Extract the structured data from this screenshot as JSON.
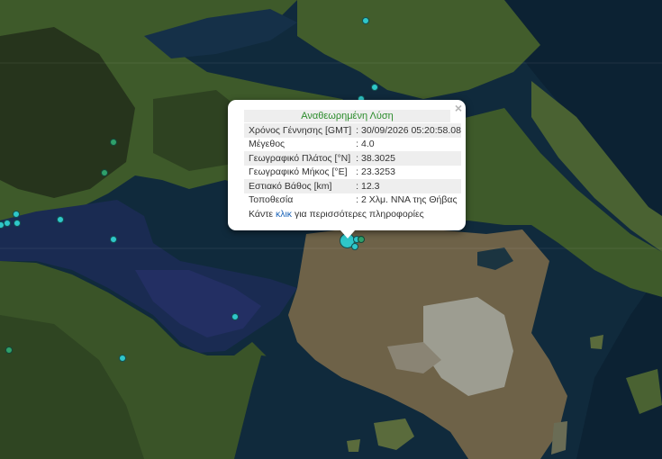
{
  "map": {
    "colors": {
      "sea": "#102a3c",
      "deep_sea": "#0c2233",
      "gulf": "#1a2b52",
      "land_green": "#3e5a2a",
      "land_dark": "#26341c",
      "land_brown": "#6e6248",
      "urban": "#9d9d91",
      "marker_cyan": "#2fc7c9",
      "marker_green": "#2fa06a"
    },
    "markers": [
      {
        "color": "#2fc7c9",
        "size": "small"
      },
      {
        "color": "#2fc7c9",
        "size": "small"
      },
      {
        "color": "#2fc7c9",
        "size": "small"
      },
      {
        "color": "#2fa06a",
        "size": "small"
      },
      {
        "color": "#2fa06a",
        "size": "small"
      },
      {
        "color": "#2fc7c9",
        "size": "small"
      },
      {
        "color": "#2fc7c9",
        "size": "small"
      },
      {
        "color": "#2fc7c9",
        "size": "small"
      },
      {
        "color": "#2fc7c9",
        "size": "small"
      },
      {
        "color": "#2fc7c9",
        "size": "small"
      },
      {
        "color": "#2fc7c9",
        "size": "small"
      },
      {
        "color": "#2fc7c9",
        "size": "small"
      },
      {
        "color": "#2fa06a",
        "size": "small"
      },
      {
        "color": "#2fc7c9",
        "size": "small"
      },
      {
        "color": "#2fc7c9",
        "size": "large"
      },
      {
        "color": "#2fc7c9",
        "size": "small"
      },
      {
        "color": "#2fc7c9",
        "size": "small"
      },
      {
        "color": "#2fa06a",
        "size": "small"
      }
    ]
  },
  "popup": {
    "title": "Αναθεωρημένη Λύση",
    "close_label": "×",
    "rows": [
      {
        "label": "Χρόνος Γέννησης [GMT]",
        "value": ": 30/09/2026 05:20:58.08"
      },
      {
        "label": "Μέγεθος",
        "value": ": 4.0"
      },
      {
        "label": "Γεωγραφικό Πλάτος [°N]",
        "value": ": 38.3025"
      },
      {
        "label": "Γεωγραφικό Μήκος [°E]",
        "value": ": 23.3253"
      },
      {
        "label": "Εστιακό Βάθος [km]",
        "value": ": 12.3"
      },
      {
        "label": "Τοποθεσία",
        "value": ": 2 Χλμ. ΝΝΑ της Θήβας"
      }
    ],
    "more": {
      "before": "Κάντε ",
      "link": "κλικ",
      "after": " για περισσότερες πληροφορίες"
    }
  }
}
